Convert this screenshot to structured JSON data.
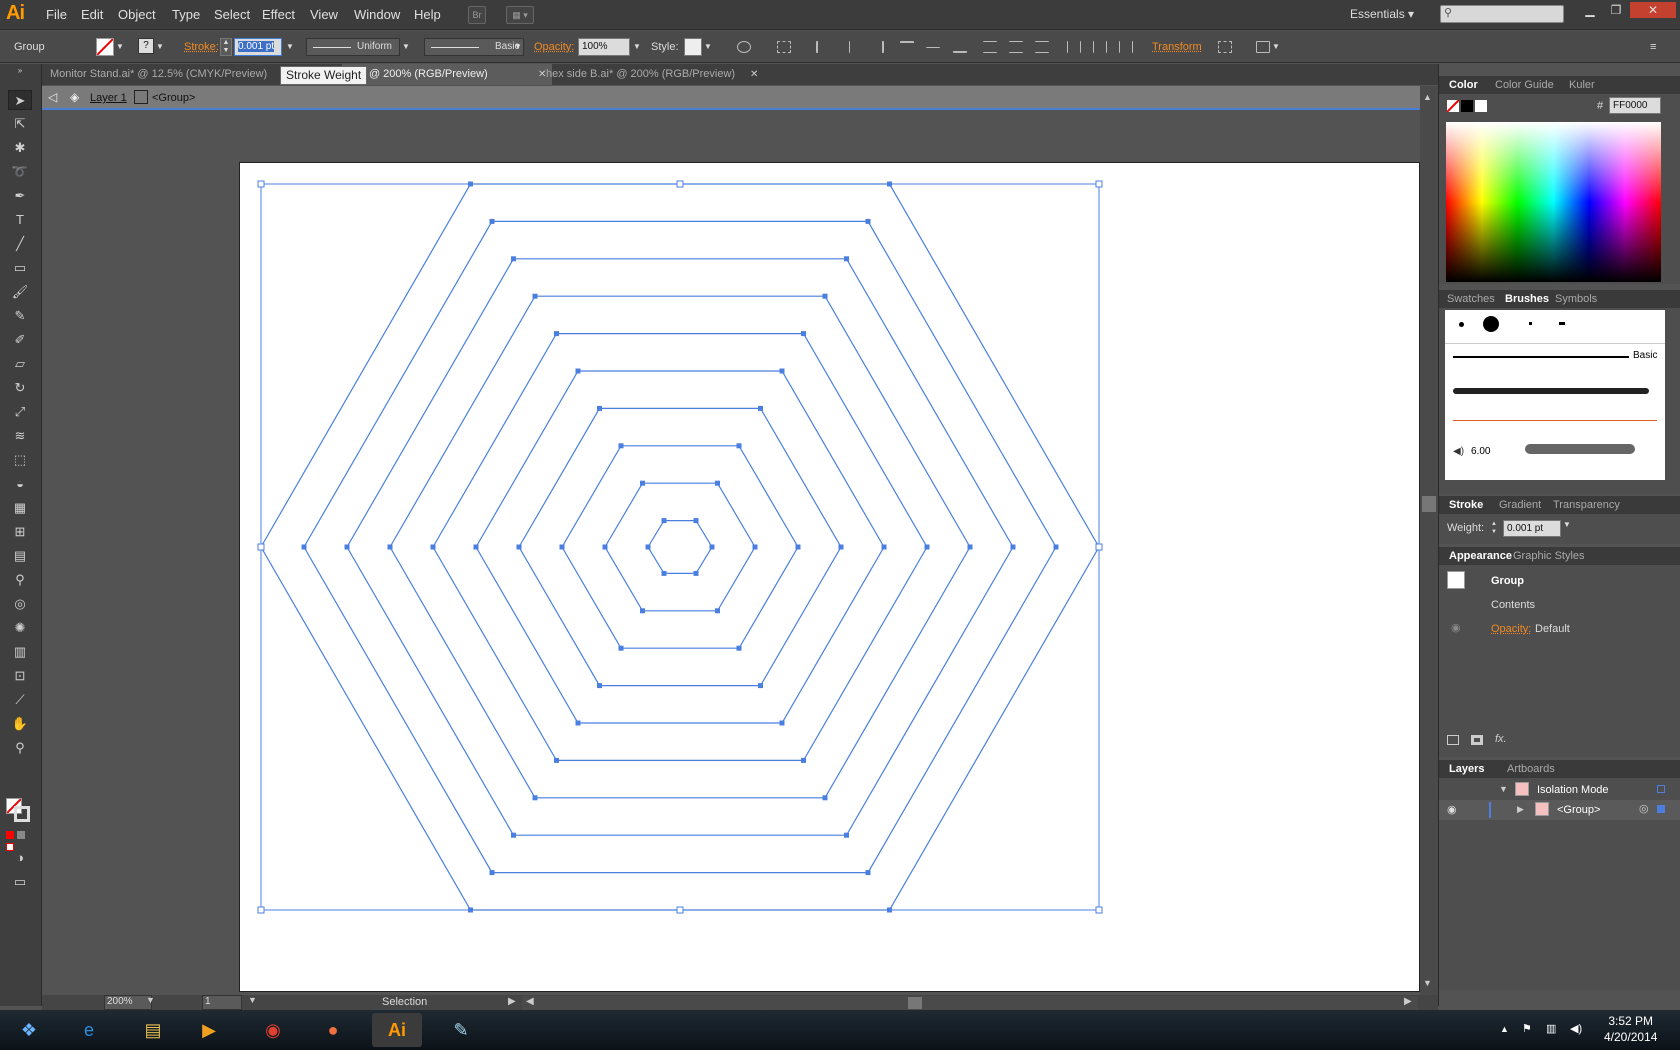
{
  "app": {
    "logo": "Ai",
    "accent": "#ff9a00"
  },
  "menu": [
    "File",
    "Edit",
    "Object",
    "Type",
    "Select",
    "Effect",
    "View",
    "Window",
    "Help"
  ],
  "menubar": {
    "bridge_label": "Br",
    "workspace": "Essentials"
  },
  "control": {
    "selection_label": "Group",
    "stroke_label": "Stroke:",
    "stroke_weight": "0.001 pt",
    "profile": "Uniform",
    "brush": "Basic",
    "opacity_label": "Opacity:",
    "opacity": "100%",
    "style_label": "Style:",
    "transform_label": "Transform"
  },
  "tooltip": "Stroke Weight",
  "tabs": [
    {
      "label": "Monitor Stand.ai* @ 12.5% (CMYK/Preview)"
    },
    {
      "label": ".ai* @ 200% (RGB/Preview)"
    },
    {
      "label": "hex side B.ai* @ 200% (RGB/Preview)"
    }
  ],
  "isolation": {
    "layer": "Layer 1",
    "group": "<Group>"
  },
  "status": {
    "zoom": "200%",
    "artboard": "1",
    "tool": "Selection"
  },
  "color_panel": {
    "tabs": [
      "Color",
      "Color Guide",
      "Kuler"
    ],
    "hex_label": "#",
    "hex": "FF0000"
  },
  "brushes_panel": {
    "tabs": [
      "Swatches",
      "Brushes",
      "Symbols"
    ],
    "basic_label": "Basic",
    "size_label": "6.00"
  },
  "stroke_panel": {
    "tabs": [
      "Stroke",
      "Gradient",
      "Transparency"
    ],
    "weight_label": "Weight:",
    "weight": "0.001 pt"
  },
  "appearance_panel": {
    "tabs": [
      "Appearance",
      "Graphic Styles"
    ],
    "group": "Group",
    "contents": "Contents",
    "opacity_label": "Opacity:",
    "opacity_value": "Default",
    "fx_label": "fx."
  },
  "layers_panel": {
    "tabs": [
      "Layers",
      "Artboards"
    ],
    "rows": [
      {
        "label": "Isolation Mode"
      },
      {
        "label": "<Group>"
      }
    ]
  },
  "taskbar": {
    "time": "3:52 PM",
    "date": "4/20/2014"
  },
  "colors": {
    "selection": "#4a7fe0",
    "swatch_red": "#ff0000"
  }
}
